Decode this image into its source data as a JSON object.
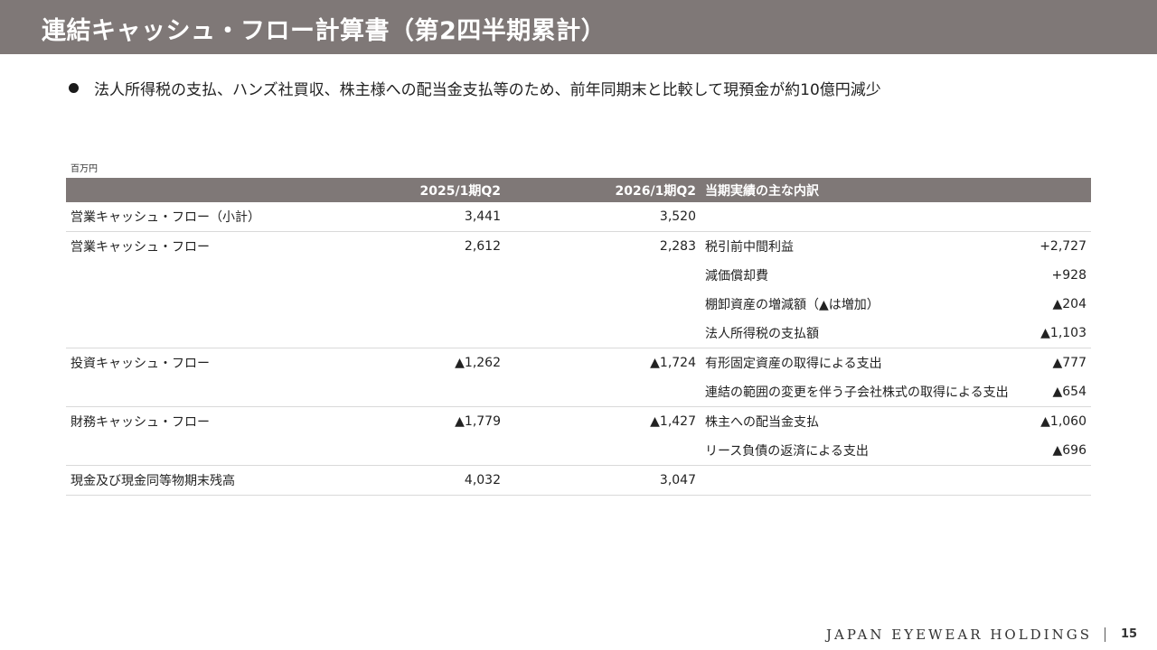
{
  "header": {
    "title": "連結キャッシュ・フロー計算書（第2四半期累計）"
  },
  "summary": {
    "bullet_text": "法人所得税の支払、ハンズ社買収、株主様への配当金支払等のため、前年同期末と比較して現預金が約10億円減少"
  },
  "table": {
    "unit_label": "百万円",
    "headers": {
      "item": "",
      "prev": "2025/1期Q2",
      "curr": "2026/1期Q2",
      "breakdown": "当期実績の主な内訳",
      "amount": ""
    },
    "rows": [
      {
        "item": "営業キャッシュ・フロー（小計）",
        "prev": "3,441",
        "curr": "3,520",
        "breakdown": "",
        "amount": ""
      },
      {
        "item": "営業キャッシュ・フロー",
        "prev": "2,612",
        "curr": "2,283",
        "breakdown": "税引前中間利益",
        "amount": "+2,727"
      },
      {
        "item": "",
        "prev": "",
        "curr": "",
        "breakdown": "減価償却費",
        "amount": "+928"
      },
      {
        "item": "",
        "prev": "",
        "curr": "",
        "breakdown": "棚卸資産の増減額（▲は増加）",
        "amount": "▲204"
      },
      {
        "item": "",
        "prev": "",
        "curr": "",
        "breakdown": "法人所得税の支払額",
        "amount": "▲1,103"
      },
      {
        "item": "投資キャッシュ・フロー",
        "prev": "▲1,262",
        "curr": "▲1,724",
        "breakdown": "有形固定資産の取得による支出",
        "amount": "▲777"
      },
      {
        "item": "",
        "prev": "",
        "curr": "",
        "breakdown": "連結の範囲の変更を伴う子会社株式の取得による支出",
        "amount": "▲654"
      },
      {
        "item": "財務キャッシュ・フロー",
        "prev": "▲1,779",
        "curr": "▲1,427",
        "breakdown": "株主への配当金支払",
        "amount": "▲1,060"
      },
      {
        "item": "",
        "prev": "",
        "curr": "",
        "breakdown": "リース負債の返済による支出",
        "amount": "▲696"
      },
      {
        "item": "現金及び現金同等物期末残高",
        "prev": "4,032",
        "curr": "3,047",
        "breakdown": "",
        "amount": ""
      }
    ]
  },
  "footer": {
    "brand": "JAPAN EYEWEAR HOLDINGS",
    "page_number": "15"
  }
}
